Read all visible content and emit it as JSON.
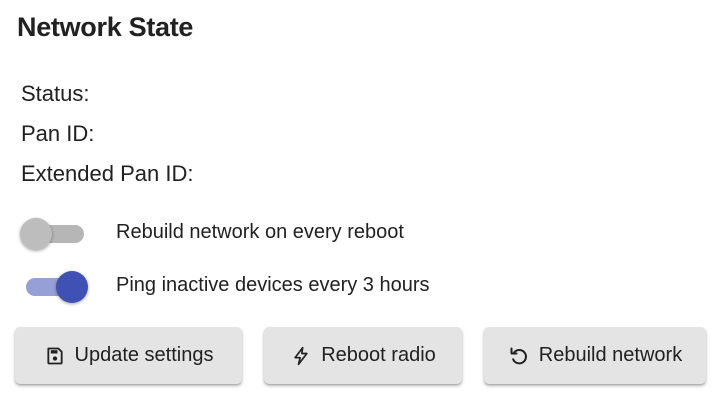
{
  "network_state": {
    "title": "Network State",
    "status_label": "Status:",
    "pan_id_label": "Pan ID:",
    "extended_pan_id_label": "Extended Pan ID:"
  },
  "settings": {
    "rebuild_on_reboot": {
      "label": "Rebuild network on every reboot",
      "checked": false
    },
    "ping_inactive": {
      "label": "Ping inactive devices every 3 hours",
      "checked": true
    }
  },
  "actions": {
    "update_settings": {
      "label": "Update settings",
      "icon": "save-icon"
    },
    "reboot_radio": {
      "label": "Reboot radio",
      "icon": "bolt-icon"
    },
    "rebuild_network": {
      "label": "Rebuild network",
      "icon": "restore-icon"
    }
  },
  "colors": {
    "accent": "#3f51b5",
    "button_bg": "#e4e4e4",
    "switch_off": "#bdbdbd"
  }
}
